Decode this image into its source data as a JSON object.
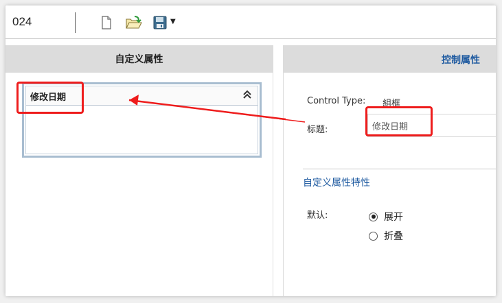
{
  "toolbar": {
    "doc_number": "024",
    "buttons": [
      {
        "name": "new-document",
        "icon": "new-document-icon"
      },
      {
        "name": "open-folder",
        "icon": "open-folder-icon"
      },
      {
        "name": "save",
        "icon": "floppy-disk-icon"
      }
    ]
  },
  "left_panel": {
    "header": "自定义属性",
    "group": {
      "title": "修改日期",
      "collapse_icon": "double-chevron-up-icon"
    }
  },
  "right_panel": {
    "header": "控制属性",
    "control_type_label": "Control Type:",
    "control_type_value": "組框",
    "title_label": "标题:",
    "title_value": "修改日期",
    "section_title": "自定义属性特性",
    "default_label": "默认:",
    "options": [
      {
        "label": "展开",
        "checked": true
      },
      {
        "label": "折叠",
        "checked": false
      }
    ]
  },
  "colors": {
    "annotation": "#ee1c1c",
    "accent": "#1e5aa0",
    "header_bg": "#dcdcdc"
  }
}
